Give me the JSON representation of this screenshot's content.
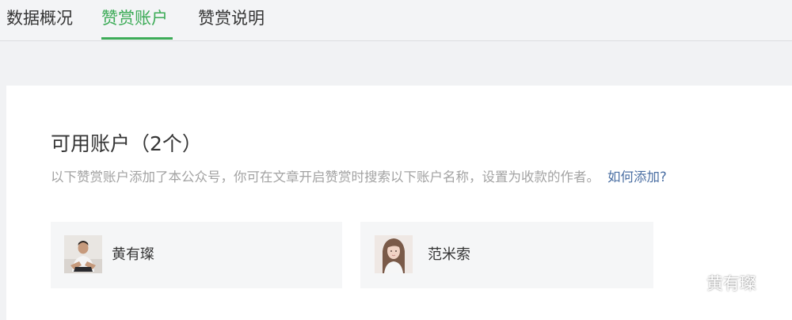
{
  "tabs": [
    {
      "label": "数据概况",
      "active": false
    },
    {
      "label": "赞赏账户",
      "active": true
    },
    {
      "label": "赞赏说明",
      "active": false
    }
  ],
  "accent_color": "#3cab57",
  "link_color": "#4b6fa3",
  "section": {
    "title": "可用账户（2个）",
    "description": "以下赞赏账户添加了本公众号，你可在文章开启赞赏时搜索以下账户名称，设置为收款的作者。",
    "help_link": "如何添加?"
  },
  "accounts": [
    {
      "name": "黄有璨",
      "avatar_icon": "avatar-man-icon"
    },
    {
      "name": "范米索",
      "avatar_icon": "avatar-woman-icon"
    }
  ],
  "watermark": {
    "text": "黄有璨",
    "icon": "wechat-icon"
  }
}
